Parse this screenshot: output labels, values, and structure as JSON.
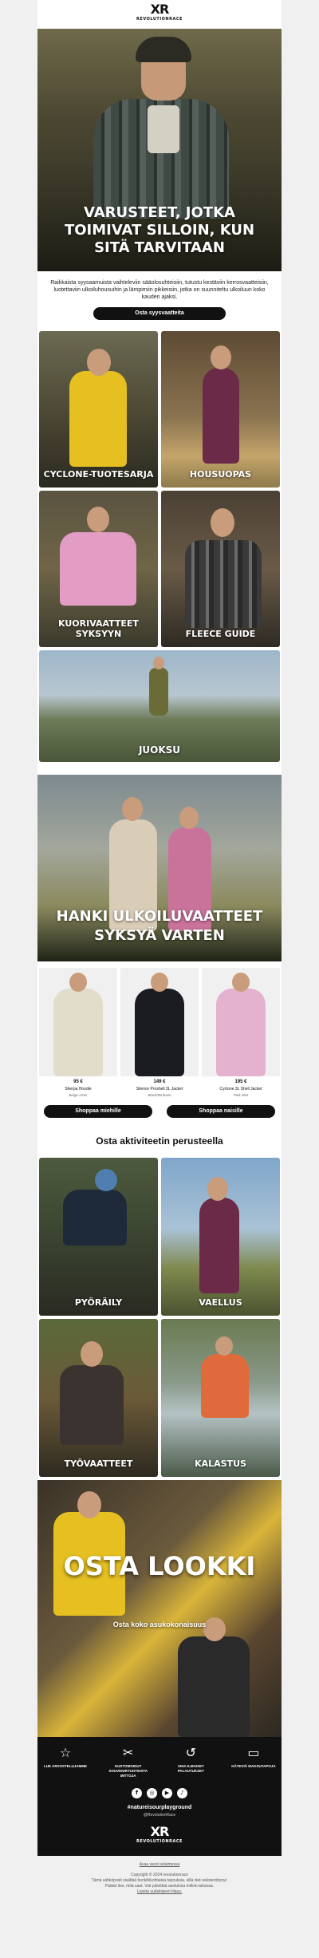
{
  "brand": {
    "logo_mark": "XR",
    "logo_text": "REVOLUTIONRACE"
  },
  "hero": {
    "headline": "VARUSTEET, JOTKA TOIMIVAT SILLOIN, KUN SITÄ TARVITAAN"
  },
  "intro": {
    "text": "Raikkaista syysaamuista vaihteleviin sääolosuhteisiin, tutustu kestäviin kerrosvaatteisiin, luotettaviin ulkoiluhousuihin ja lämpimiin pikkeisiin, jotka on suunniteltu ulkoiluun koko kauden ajaksi.",
    "cta": "Osta syysvaatteita"
  },
  "categories": [
    {
      "label": "CYCLONE-TUOTESARJA"
    },
    {
      "label": "HOUSUOPAS"
    },
    {
      "label": "KUORIVAATTEET SYKSYYN"
    },
    {
      "label": "FLEECE GUIDE"
    }
  ],
  "wide_banner": {
    "label": "JUOKSU"
  },
  "autumn": {
    "headline": "HANKI ULKOILUVAATTEET SYKSYÄ VARTEN"
  },
  "products": [
    {
      "price": "95 €",
      "name": "Sherpa Hoodie",
      "color": "Beige Amer"
    },
    {
      "price": "149 €",
      "name": "Silence Proshell 3L Jacket",
      "color": "Black/Bruhaze"
    },
    {
      "price": "195 €",
      "name": "Cyclone 3L Shell Jacket",
      "color": "Pink Mist"
    }
  ],
  "product_ctas": {
    "men": "Shoppaa miehille",
    "women": "Shoppaa naisille"
  },
  "activities": {
    "title": "Osta aktiviteetin perusteella",
    "items": [
      {
        "label": "PYÖRÄILY"
      },
      {
        "label": "VAELLUS"
      },
      {
        "label": "TYÖVAATTEET"
      },
      {
        "label": "KALASTUS"
      }
    ]
  },
  "look": {
    "headline": "OSTA LOOKKI",
    "sub": "Osta koko asukokonaisuus"
  },
  "footer": {
    "usps": [
      {
        "icon": "star-icon",
        "glyph": "☆",
        "text": "LUE ARVOSTELUJAMME"
      },
      {
        "icon": "scissors-icon",
        "glyph": "✂",
        "text": "KUSTOMOIDUT SOUVENIRTUOTEISTA MITTOJA"
      },
      {
        "icon": "return-icon",
        "glyph": "↺",
        "text": "AINA ILMAISET PALAUTUKSET"
      },
      {
        "icon": "credit-card-icon",
        "glyph": "▭",
        "text": "KÄTEVIÄ MAKSUTAPOJA"
      }
    ],
    "social": [
      {
        "icon": "facebook-icon",
        "glyph": "f"
      },
      {
        "icon": "instagram-icon",
        "glyph": "◎"
      },
      {
        "icon": "youtube-icon",
        "glyph": "▶"
      },
      {
        "icon": "tiktok-icon",
        "glyph": "♪"
      }
    ],
    "hashtag": "#natureisourplayground",
    "handle": "@RevolutionRace"
  },
  "legal": {
    "link_top": "Avaa viesti selaimessa",
    "copyright": "Copyright © 2024 revolutionrace",
    "line1": "Tämä sähköposti sisältää henkilökohtaisia tarjouksia, sillä olet rekisteröitynyt.",
    "line2": "Päätät itse, mitä saat. Voit päivittää asetuksia milloin tahansa.",
    "unsubscribe": "Lopeta uutiskirjeen tilaus."
  },
  "colors": {
    "button_bg": "#111111",
    "footer_bg": "#111111"
  }
}
